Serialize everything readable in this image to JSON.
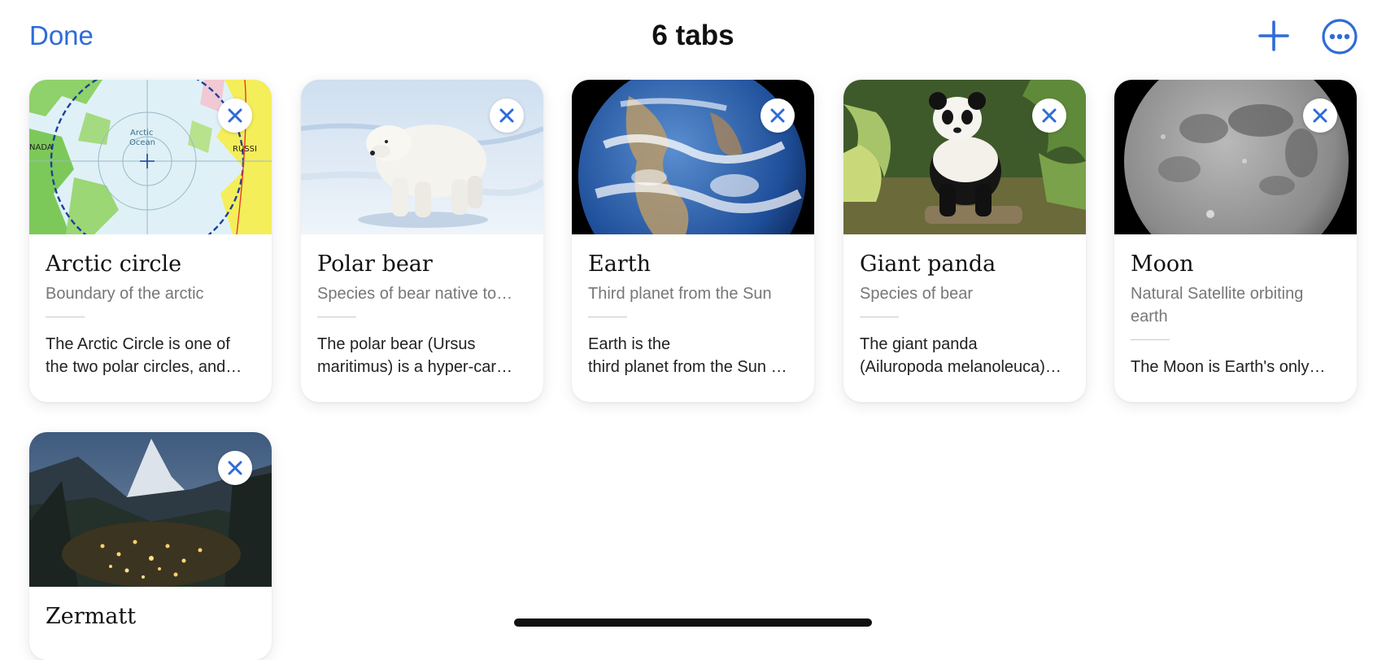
{
  "header": {
    "done_label": "Done",
    "title": "6 tabs",
    "add_icon": "plus-icon",
    "more_icon": "ellipsis-circle-icon"
  },
  "colors": {
    "accent": "#2f6bd8",
    "background": "#ffffff"
  },
  "tabs": [
    {
      "title": "Arctic circle",
      "subtitle": "Boundary of the arctic",
      "description_lines": [
        "The Arctic Circle is one of",
        "the two polar circles, and…"
      ],
      "image": "arctic-map",
      "map_labels": {
        "ocean": "Arctic",
        "ocean2": "Ocean",
        "left": "NADA",
        "right": "RUSSI"
      }
    },
    {
      "title": "Polar bear",
      "subtitle": "Species of bear native to…",
      "description_lines": [
        "The polar bear (Ursus",
        "maritimus) is a hyper-car…"
      ],
      "image": "polar-bear-photo"
    },
    {
      "title": "Earth",
      "subtitle": "Third planet from the Sun",
      "description_lines": [
        "Earth is the",
        "third planet from the Sun …"
      ],
      "image": "earth-photo"
    },
    {
      "title": "Giant panda",
      "subtitle": "Species of bear",
      "description_lines": [
        "The giant panda",
        "(Ailuropoda melanoleuca)…"
      ],
      "image": "giant-panda-photo"
    },
    {
      "title": "Moon",
      "subtitle": "Natural Satellite orbiting earth",
      "description_lines": [
        "The Moon is Earth's only…"
      ],
      "image": "moon-photo"
    },
    {
      "title": "Zermatt",
      "subtitle": "",
      "description_lines": [],
      "image": "zermatt-photo"
    }
  ]
}
